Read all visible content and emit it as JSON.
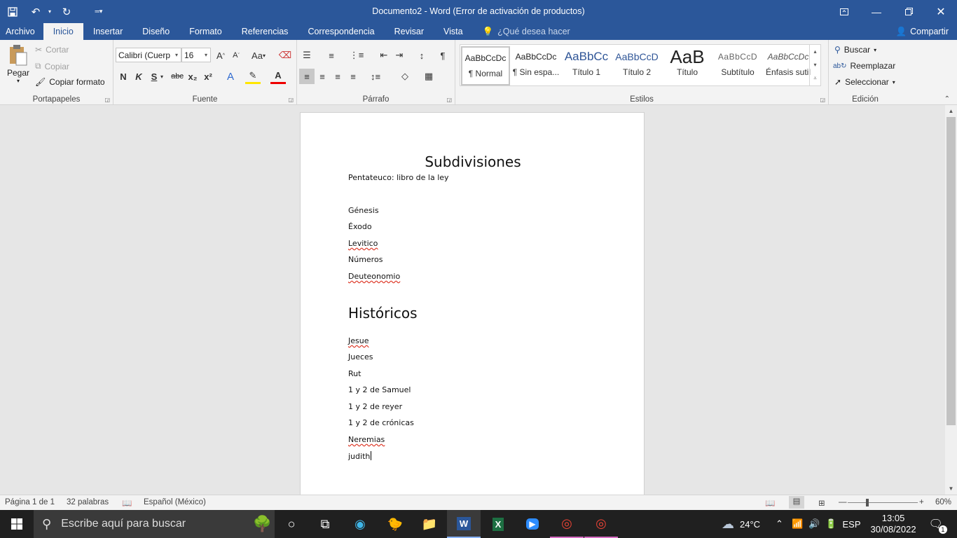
{
  "titlebar": {
    "title": "Documento2  -  Word (Error de activación de productos)"
  },
  "menu": {
    "tabs": [
      "Archivo",
      "Inicio",
      "Insertar",
      "Diseño",
      "Formato",
      "Referencias",
      "Correspondencia",
      "Revisar",
      "Vista"
    ],
    "tell_me": "¿Qué desea hacer",
    "share": "Compartir"
  },
  "ribbon": {
    "clipboard": {
      "paste": "Pegar",
      "cut": "Cortar",
      "copy": "Copiar",
      "format_painter": "Copiar formato",
      "label": "Portapapeles"
    },
    "font": {
      "font_name": "Calibri (Cuerp",
      "font_size": "16",
      "label": "Fuente",
      "bold": "N",
      "italic": "K",
      "underline": "S",
      "strike": "abc",
      "subscript": "x₂",
      "superscript": "x²",
      "case": "Aa"
    },
    "paragraph": {
      "label": "Párrafo"
    },
    "styles": {
      "label": "Estilos",
      "items": [
        {
          "sample": "AaBbCcDc",
          "name": "¶ Normal"
        },
        {
          "sample": "AaBbCcDc",
          "name": "¶ Sin espa..."
        },
        {
          "sample": "AaBbCc",
          "name": "Título 1"
        },
        {
          "sample": "AaBbCcD",
          "name": "Título 2"
        },
        {
          "sample": "AaB",
          "name": "Título"
        },
        {
          "sample": "AaBbCcD",
          "name": "Subtítulo"
        },
        {
          "sample": "AaBbCcDc",
          "name": "Énfasis sutil"
        }
      ]
    },
    "editing": {
      "find": "Buscar",
      "replace": "Reemplazar",
      "select": "Seleccionar",
      "label": "Edición"
    }
  },
  "document": {
    "title": "Subdivisiones",
    "intro": "Pentateuco: libro de la ley",
    "pentateuco": [
      "Génesis",
      "Éxodo",
      "Levitico",
      "Números",
      "Deuteonomio"
    ],
    "heading2": "Históricos",
    "historicos": [
      "Jesue",
      "Jueces",
      "Rut",
      "1 y 2 de Samuel",
      "1 y 2 de reyer",
      "1 y 2 de crónicas",
      "Neremias",
      "judith"
    ]
  },
  "status": {
    "page": "Página 1 de 1",
    "words": "32 palabras",
    "language": "Español (México)",
    "zoom": "60%"
  },
  "taskbar": {
    "search_placeholder": "Escribe aquí para buscar",
    "weather": "24°C",
    "lang": "ESP",
    "time": "13:05",
    "date": "30/08/2022",
    "notifications": "1"
  },
  "colors": {
    "word_blue": "#2b579a",
    "taskbar": "#202020"
  }
}
